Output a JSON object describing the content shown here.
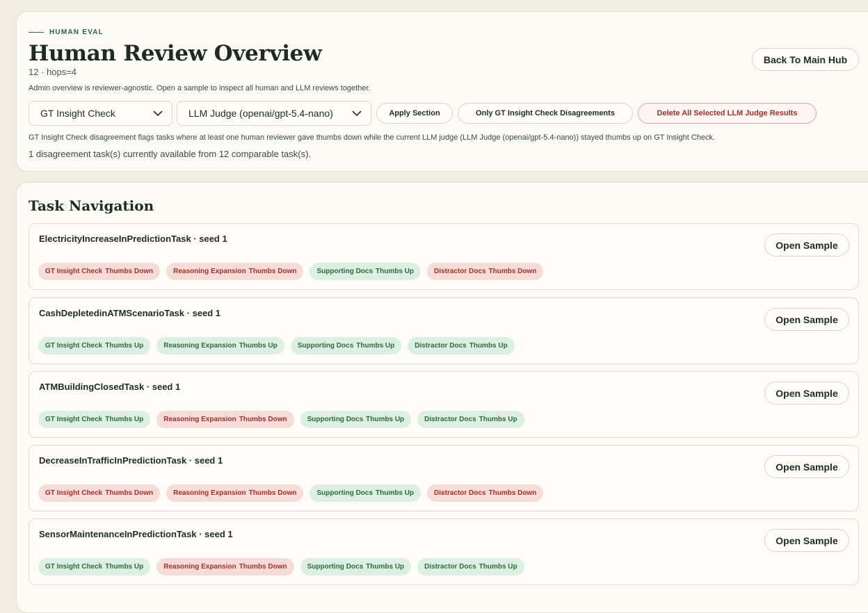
{
  "header": {
    "eyebrow": "HUMAN EVAL",
    "title": "Human Review Overview",
    "subtitle": "12 · hops=4",
    "admin_note": "Admin overview is reviewer-agnostic. Open a sample to inspect all human and LLM reviews together.",
    "back_button": "Back To Main Hub"
  },
  "controls": {
    "section_select": "GT Insight Check",
    "judge_select": "LLM Judge (openai/gpt-5.4-nano)",
    "apply_button": "Apply Section",
    "only_disagreements_button": "Only GT Insight Check Disagreements",
    "delete_button": "Delete All Selected LLM Judge Results"
  },
  "notes": {
    "flag_note": "GT Insight Check disagreement flags tasks where at least one human reviewer gave thumbs down while the current LLM judge (LLM Judge (openai/gpt-5.4-nano)) stayed thumbs up on GT Insight Check.",
    "count_note": "1 disagreement task(s) currently available from 12 comparable task(s)."
  },
  "navigation": {
    "title": "Task Navigation",
    "open_label": "Open Sample",
    "tasks": [
      {
        "name": "ElectricityIncreaseInPredictionTask · seed 1",
        "badges": [
          {
            "label": "GT Insight Check",
            "value": "Thumbs Down",
            "status": "down"
          },
          {
            "label": "Reasoning Expansion",
            "value": "Thumbs Down",
            "status": "down"
          },
          {
            "label": "Supporting Docs",
            "value": "Thumbs Up",
            "status": "up"
          },
          {
            "label": "Distractor Docs",
            "value": "Thumbs Down",
            "status": "down"
          }
        ]
      },
      {
        "name": "CashDepletedinATMScenarioTask · seed 1",
        "badges": [
          {
            "label": "GT Insight Check",
            "value": "Thumbs Up",
            "status": "up"
          },
          {
            "label": "Reasoning Expansion",
            "value": "Thumbs Up",
            "status": "up"
          },
          {
            "label": "Supporting Docs",
            "value": "Thumbs Up",
            "status": "up"
          },
          {
            "label": "Distractor Docs",
            "value": "Thumbs Up",
            "status": "up"
          }
        ]
      },
      {
        "name": "ATMBuildingClosedTask · seed 1",
        "badges": [
          {
            "label": "GT Insight Check",
            "value": "Thumbs Up",
            "status": "up"
          },
          {
            "label": "Reasoning Expansion",
            "value": "Thumbs Down",
            "status": "down"
          },
          {
            "label": "Supporting Docs",
            "value": "Thumbs Up",
            "status": "up"
          },
          {
            "label": "Distractor Docs",
            "value": "Thumbs Up",
            "status": "up"
          }
        ]
      },
      {
        "name": "DecreaseInTrafficInPredictionTask · seed 1",
        "badges": [
          {
            "label": "GT Insight Check",
            "value": "Thumbs Down",
            "status": "down"
          },
          {
            "label": "Reasoning Expansion",
            "value": "Thumbs Down",
            "status": "down"
          },
          {
            "label": "Supporting Docs",
            "value": "Thumbs Up",
            "status": "up"
          },
          {
            "label": "Distractor Docs",
            "value": "Thumbs Down",
            "status": "down"
          }
        ]
      },
      {
        "name": "SensorMaintenanceInPredictionTask · seed 1",
        "badges": [
          {
            "label": "GT Insight Check",
            "value": "Thumbs Up",
            "status": "up"
          },
          {
            "label": "Reasoning Expansion",
            "value": "Thumbs Down",
            "status": "down"
          },
          {
            "label": "Supporting Docs",
            "value": "Thumbs Up",
            "status": "up"
          },
          {
            "label": "Distractor Docs",
            "value": "Thumbs Up",
            "status": "up"
          }
        ]
      }
    ]
  }
}
